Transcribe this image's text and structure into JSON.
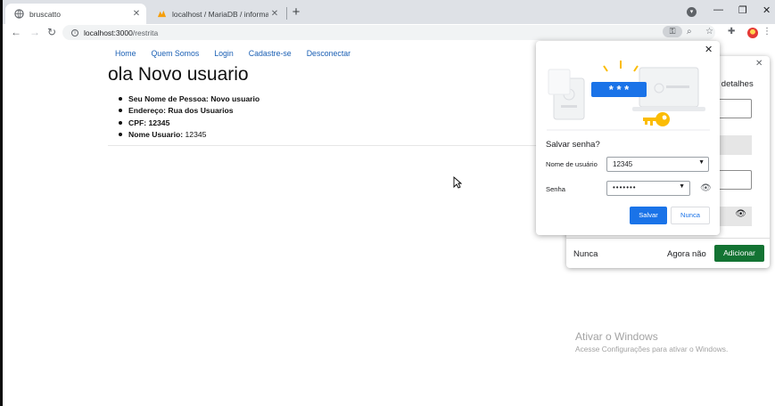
{
  "browser": {
    "tabs": [
      {
        "title": "bruscatto",
        "active": true
      },
      {
        "title": "localhost / MariaDB / informativ",
        "active": false
      }
    ],
    "new_tab_label": "+",
    "window_controls": [
      "minimize",
      "restore",
      "close"
    ],
    "address": {
      "host": "localhost:3000",
      "path": "/restrita"
    }
  },
  "page": {
    "nav": [
      "Home",
      "Quem Somos",
      "Login",
      "Cadastre-se",
      "Desconectar"
    ],
    "heading": "ola Novo usuario",
    "details": [
      {
        "label": "Seu Nome de Pessoa:",
        "value": "Novo usuario",
        "value_bold": true
      },
      {
        "label": "Endereço:",
        "value": "Rua dos Usuarios",
        "value_bold": true
      },
      {
        "label": "CPF:",
        "value": "12345",
        "value_bold": true
      },
      {
        "label": "Nome Usuario:",
        "value": "12345",
        "value_bold": false
      }
    ]
  },
  "background_dialog": {
    "partial_text": "r detalhes",
    "never_label": "Nunca",
    "not_now_label": "Agora não",
    "add_label": "Adicionar"
  },
  "password_bubble": {
    "question": "Salvar senha?",
    "username_label": "Nome de usuário",
    "username_value": "12345",
    "password_label": "Senha",
    "password_value": "•••••••",
    "save_label": "Salvar",
    "never_label": "Nunca",
    "illustration_text": "* * *"
  },
  "watermark": {
    "title": "Ativar o Windows",
    "subtitle": "Acesse Configurações para ativar o Windows."
  },
  "colors": {
    "link": "#1a5fb4",
    "primary_button": "#1a73e8",
    "add_button": "#137333"
  }
}
